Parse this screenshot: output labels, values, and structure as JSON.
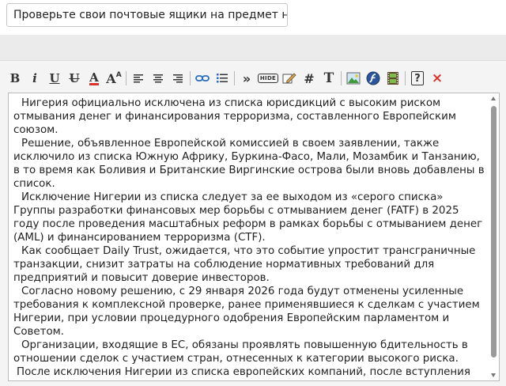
{
  "title_field": {
    "value": "Проверьте свои почтовые ящики на предмет нас"
  },
  "toolbar": {
    "buttons": [
      {
        "name": "bold-icon",
        "glyph": "B"
      },
      {
        "name": "italic-icon",
        "glyph": "i"
      },
      {
        "name": "underline-icon",
        "glyph": "U"
      },
      {
        "name": "strikethrough-icon",
        "glyph": "U"
      },
      {
        "name": "font-color-icon",
        "glyph": "A"
      },
      {
        "name": "font-size-icon",
        "glyph": "A"
      },
      {
        "name": "align-left-icon"
      },
      {
        "name": "align-center-icon"
      },
      {
        "name": "align-right-icon"
      },
      {
        "name": "link-icon"
      },
      {
        "name": "list-icon"
      },
      {
        "name": "quote-icon",
        "glyph": "»"
      },
      {
        "name": "hide-icon",
        "glyph": "HIDE"
      },
      {
        "name": "edit-icon"
      },
      {
        "name": "hash-icon",
        "glyph": "#"
      },
      {
        "name": "text-format-icon",
        "glyph": "T"
      },
      {
        "name": "image-icon"
      },
      {
        "name": "flash-icon"
      },
      {
        "name": "video-icon"
      },
      {
        "name": "help-icon",
        "glyph": "?"
      },
      {
        "name": "close-icon",
        "glyph": "×"
      }
    ],
    "accent_red": "#d9342b",
    "accent_blue": "#2b6cc4"
  },
  "editor": {
    "paragraphs": [
      "Нигерия официально исключена из списка юрисдикций с высоким риском отмывания денег и финансирования терроризма, составленного Европейским союзом.",
      "Решение, объявленное Европейской комиссией в своем заявлении, также исключило из списка Южную Африку, Буркина-Фасо, Мали, Мозамбик и Танзанию, в то время как Боливия и Британские Виргинские острова были вновь добавлены в список.",
      "Исключение Нигерии из списка следует за ее выходом из «серого списка» Группы разработки финансовых мер борьбы с отмыванием денег (FATF) в 2025 году после проведения масштабных реформ в рамках борьбы с отмыванием денег (AML) и финансированием терроризма (CTF).",
      "Как сообщает Daily Trust, ожидается, что это событие упростит трансграничные транзакции, снизит затраты на соблюдение нормативных требований для предприятий и повысит доверие инвесторов.",
      "Согласно новому решению, с 29 января 2026 года будут отменены усиленные требования к комплексной проверке, ранее применявшиеся к сделкам с участием Нигерии, при условии процедурного одобрения Европейским парламентом и Советом.",
      "Организации, входящие в ЕС, обязаны проявлять повышенную бдительность в отношении сделок с участием стран, отнесенных к категории высокого риска.",
      "После исключения Нигерии из списка европейских компаний, после вступления"
    ]
  }
}
